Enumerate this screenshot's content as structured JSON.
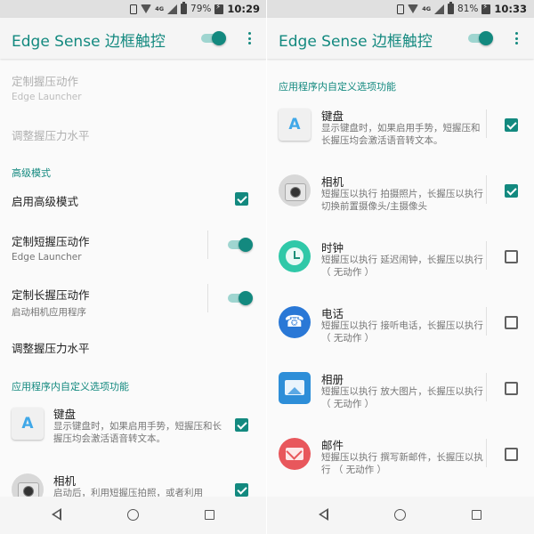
{
  "left_screen": {
    "status": {
      "network": "4G",
      "battery_percent": "79%",
      "time": "10:29"
    },
    "app_title": "Edge Sense 边框触控",
    "master_switch_on": true,
    "items": [
      {
        "title": "定制握压动作",
        "subtitle": "Edge Launcher",
        "disabled": true
      },
      {
        "title": "调整握压力水平",
        "disabled": true
      }
    ],
    "advanced_header": "高级模式",
    "advanced": {
      "enable_label": "启用高级模式",
      "enable_checked": true,
      "short": {
        "title": "定制短握压动作",
        "subtitle": "Edge Launcher",
        "switch_on": true
      },
      "long": {
        "title": "定制长握压动作",
        "subtitle": "启动相机应用程序",
        "switch_on": true
      },
      "adjust": {
        "title": "调整握压力水平"
      }
    },
    "inapp_header": "应用程序内自定义选项功能",
    "features": [
      {
        "icon": "keyboard-icon",
        "title": "键盘",
        "desc": "显示键盘时，如果启用手势，短握压和长握压均会激活语音转文本。",
        "checked": true
      },
      {
        "icon": "camera-icon",
        "title": "相机",
        "desc": "启动后，利用短握压拍照，或者利用",
        "checked": true
      }
    ]
  },
  "right_screen": {
    "status": {
      "network": "4G",
      "battery_percent": "81%",
      "time": "10:33"
    },
    "app_title": "Edge Sense 边框触控",
    "master_switch_on": true,
    "inapp_header": "应用程序内自定义选项功能",
    "features": [
      {
        "icon": "keyboard-icon",
        "title": "键盘",
        "desc": "显示键盘时，如果启用手势，短握压和长握压均会激活语音转文本。",
        "checked": true
      },
      {
        "icon": "camera-icon",
        "title": "相机",
        "desc": "短握压以执行 拍摄照片，长握压以执行 切换前置摄像头/主摄像头",
        "checked": true
      },
      {
        "icon": "clock-icon",
        "title": "时钟",
        "desc": "短握压以执行 延迟闹钟，长握压以执行 （ 无动作 ）",
        "checked": false
      },
      {
        "icon": "phone-icon",
        "title": "电话",
        "desc": "短握压以执行 接听电话，长握压以执行 （ 无动作 ）",
        "checked": false
      },
      {
        "icon": "gallery-icon",
        "title": "相册",
        "desc": "短握压以执行 放大图片，长握压以执行 （ 无动作 ）",
        "checked": false
      },
      {
        "icon": "mail-icon",
        "title": "邮件",
        "desc": "短握压以执行 撰写新邮件，长握压以执行 （ 无动作 ）",
        "checked": false
      }
    ]
  },
  "colors": {
    "accent": "#13897f",
    "accent_light": "#9fd5d0",
    "status_bar": "#e0e0e0",
    "background": "#fafafa"
  },
  "nav": {
    "icons": [
      "back-icon",
      "home-icon",
      "recents-icon"
    ]
  }
}
